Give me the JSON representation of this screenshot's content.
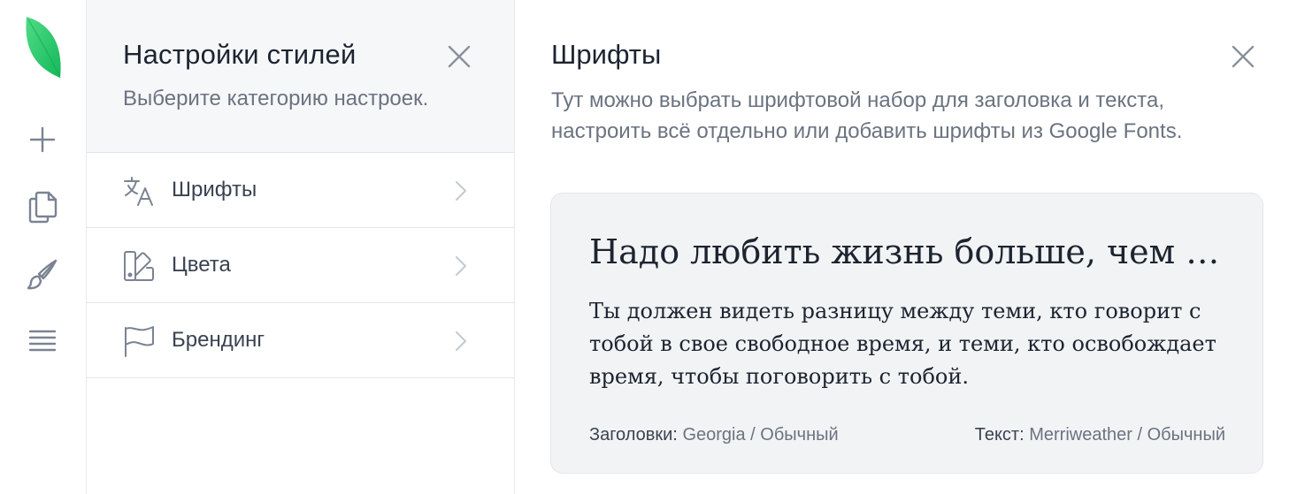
{
  "colors": {
    "brand_green": "#2ecc71",
    "brand_green_dark": "#1fa85a",
    "muted_text": "#6b7380",
    "card_bg": "#f2f3f5"
  },
  "rail": {
    "logo": "leaf-logo",
    "tools": [
      {
        "name": "add",
        "icon": "plus-icon"
      },
      {
        "name": "pages",
        "icon": "copy-icon"
      },
      {
        "name": "styles",
        "icon": "brush-icon"
      },
      {
        "name": "layers",
        "icon": "lines-icon"
      }
    ]
  },
  "panel": {
    "title": "Настройки стилей",
    "subtitle": "Выберите категорию настроек.",
    "items": [
      {
        "label": "Шрифты",
        "icon": "translate-icon"
      },
      {
        "label": "Цвета",
        "icon": "palette-icon"
      },
      {
        "label": "Брендинг",
        "icon": "flag-icon"
      }
    ]
  },
  "detail": {
    "title": "Шрифты",
    "subtitle": "Тут можно выбрать шрифтовой набор для заголовка и текста, настроить всё отдельно или добавить шрифты из Google Fonts.",
    "card": {
      "heading": "Надо любить жизнь больше, чем смысл жизни.",
      "body": "Ты должен видеть разницу между теми, кто говорит с тобой в свое свободное время, и теми, кто освобождает время, чтобы поговорить с тобой.",
      "heading_label": "Заголовки:",
      "heading_font": "Georgia / Обычный",
      "body_label": "Текст:",
      "body_font": "Merriweather / Обычный"
    }
  }
}
